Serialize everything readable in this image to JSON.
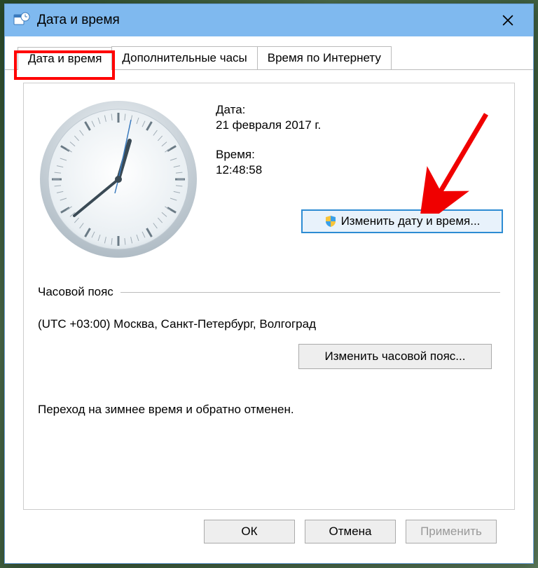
{
  "titlebar": {
    "title": "Дата и время"
  },
  "tabs": [
    {
      "label": "Дата и время"
    },
    {
      "label": "Дополнительные часы"
    },
    {
      "label": "Время по Интернету"
    }
  ],
  "date": {
    "label": "Дата:",
    "value": "21 февраля 2017 г."
  },
  "time": {
    "label": "Время:",
    "value": "12:48:58"
  },
  "buttons": {
    "change_datetime": "Изменить дату и время...",
    "change_timezone": "Изменить часовой пояс...",
    "ok": "ОК",
    "cancel": "Отмена",
    "apply": "Применить"
  },
  "timezone": {
    "header": "Часовой пояс",
    "value": "(UTC +03:00) Москва, Санкт-Петербург, Волгоград"
  },
  "dst_note": "Переход на зимнее время и обратно отменен.",
  "colors": {
    "titlebar": "#7fb9ef",
    "accent": "#2d8cd3",
    "highlight": "#f00000"
  }
}
